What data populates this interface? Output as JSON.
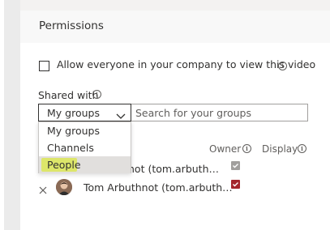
{
  "panel": {
    "title": "Permissions"
  },
  "allow_everyone": {
    "label": "Allow everyone in your company to view this video",
    "checked": false
  },
  "shared_with": {
    "label": "Shared with",
    "dropdown_value": "My groups",
    "search_placeholder": "Search for your groups",
    "menu_options": [
      "My groups",
      "Channels",
      "People"
    ],
    "highlighted_option": "People"
  },
  "columns": {
    "owner": "Owner",
    "display": "Display"
  },
  "rows": [
    {
      "name": "not (tom.arbuth…",
      "owner_checked": true,
      "owner_disabled": true
    },
    {
      "name": "Tom Arbuthnot (tom.arbuth…",
      "owner_checked": true,
      "owner_disabled": false
    }
  ],
  "colors": {
    "accent": "#a4262c",
    "disabled_check": "#a19f9d",
    "highlight": "#dde66a"
  },
  "icons": {
    "info": "info-icon",
    "chevron": "chevron-down-icon",
    "remove": "close-icon",
    "check": "checkmark-icon"
  }
}
